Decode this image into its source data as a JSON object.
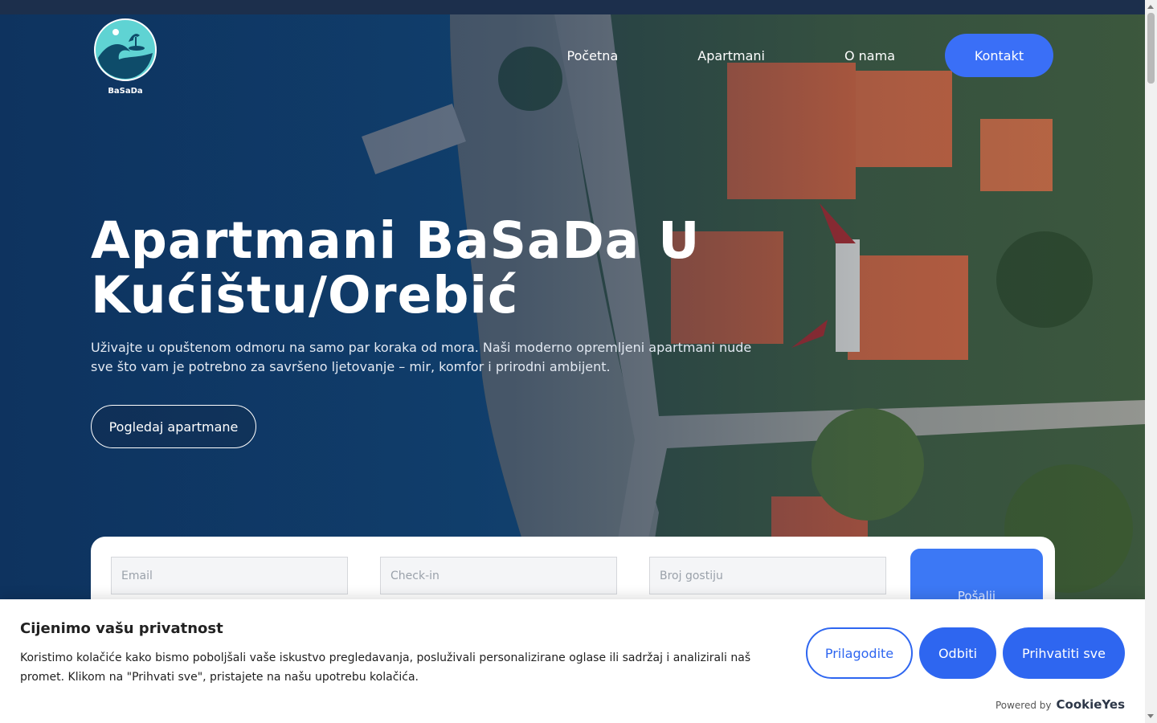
{
  "brand": {
    "logo_text": "BaSaDa"
  },
  "nav": {
    "items": [
      {
        "label": "Početna"
      },
      {
        "label": "Apartmani"
      },
      {
        "label": "O nama"
      }
    ],
    "contact_label": "Kontakt"
  },
  "hero": {
    "title_line1": "Apartmani BaSaDa U",
    "title_line2": "Kućištu/Orebić",
    "subtitle": "Uživajte u opuštenom odmoru na samo par koraka od mora. Naši moderno opremljeni apartmani nude sve što vam je potrebno za savršeno ljetovanje – mir, komfor i prirodni ambijent.",
    "cta_label": "Pogledaj apartmane"
  },
  "booking": {
    "email_placeholder": "Email",
    "checkin_placeholder": "Check-in",
    "guests_placeholder": "Broj gostiju",
    "submit_label": "Pošalji"
  },
  "cookie": {
    "title": "Cijenimo vašu privatnost",
    "text": "Koristimo kolačiće kako bismo poboljšali vaše iskustvo pregledavanja, posluživali personalizirane oglase ili sadržaj i analizirali naš promet. Klikom na \"Prihvati sve\", pristajete na našu upotrebu kolačića.",
    "customize_label": "Prilagodite",
    "reject_label": "Odbiti",
    "accept_label": "Prihvatiti sve",
    "powered_by": "Powered by",
    "powered_brand": "CookieYes"
  },
  "colors": {
    "accent": "#3a6ff7",
    "cookie_accent": "#2e66f0"
  }
}
